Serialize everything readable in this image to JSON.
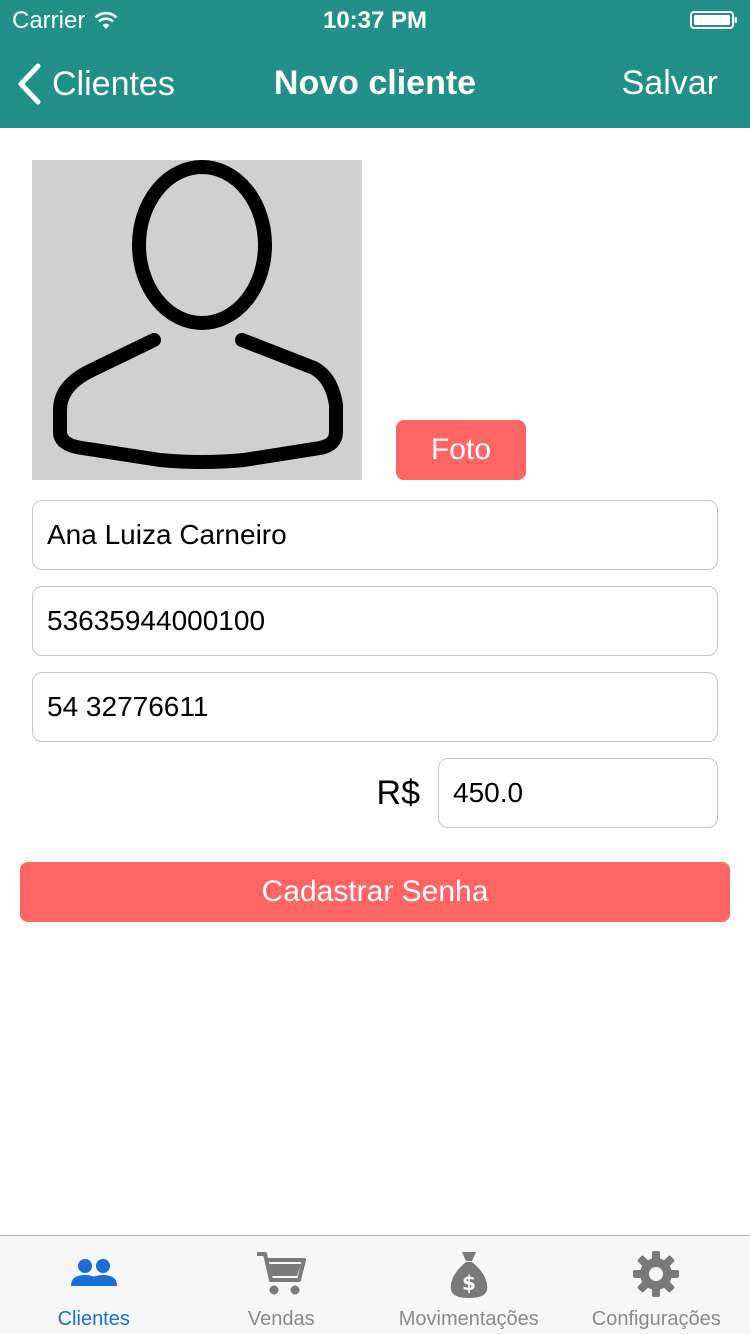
{
  "status_bar": {
    "carrier": "Carrier",
    "time": "10:37 PM"
  },
  "nav": {
    "back_label": "Clientes",
    "title": "Novo cliente",
    "save_label": "Salvar"
  },
  "profile": {
    "photo_button_label": "Foto"
  },
  "form": {
    "name": "Ana Luiza Carneiro",
    "document": "53635944000100",
    "phone": "54 32776611",
    "currency_label": "R$",
    "credit_value": "450.0"
  },
  "actions": {
    "register_password_label": "Cadastrar Senha"
  },
  "tabs": [
    {
      "label": "Clientes",
      "icon": "users-icon",
      "active": true
    },
    {
      "label": "Vendas",
      "icon": "cart-icon",
      "active": false
    },
    {
      "label": "Movimentações",
      "icon": "money-bag-icon",
      "active": false
    },
    {
      "label": "Configurações",
      "icon": "gear-icon",
      "active": false
    }
  ],
  "colors": {
    "nav": "#219088",
    "accent_button": "#ff6565",
    "tab_active": "#1a6fd6",
    "tab_inactive": "#8a8a8a"
  }
}
